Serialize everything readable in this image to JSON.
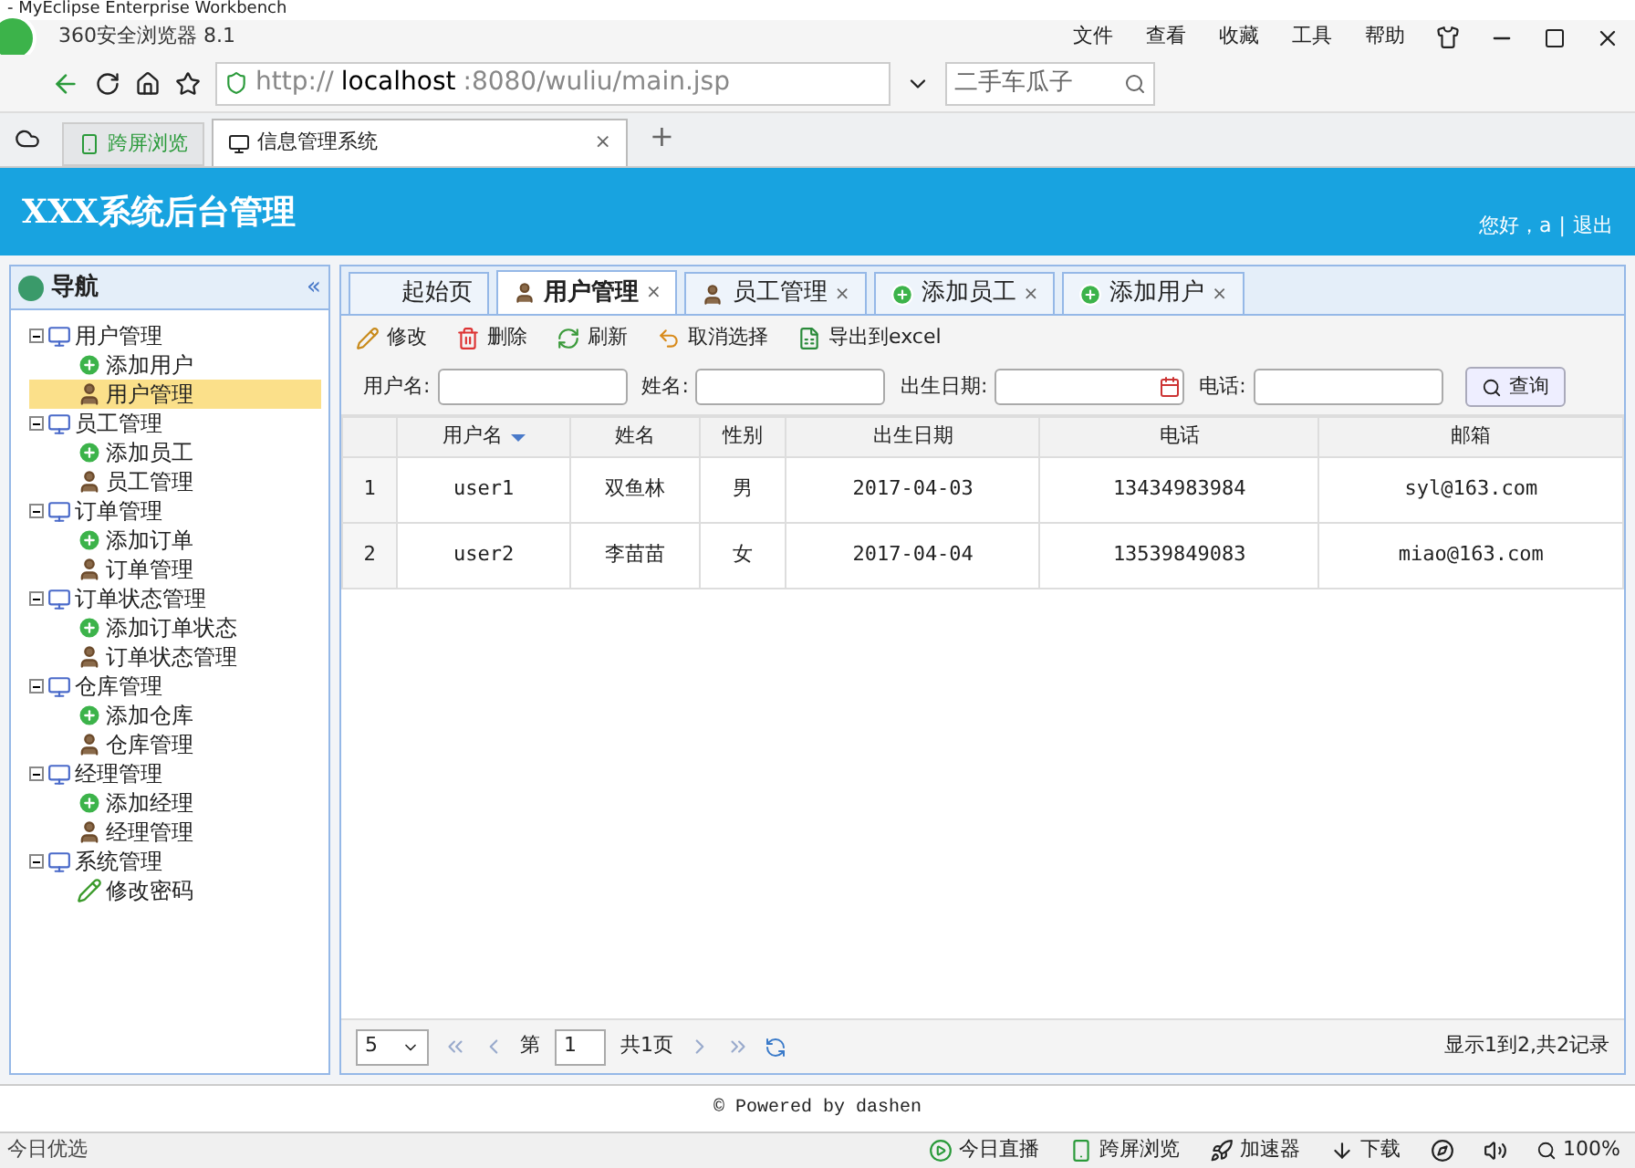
{
  "ide_title": "- MyEclipse Enterprise Workbench",
  "browser": {
    "title": "360安全浏览器 8.1",
    "menu": [
      "文件",
      "查看",
      "收藏",
      "工具",
      "帮助"
    ],
    "url_prefix": "http://",
    "url_host": "localhost",
    "url_rest": ":8080/wuliu/main.jsp",
    "search_placeholder": "二手车瓜子",
    "tabs": [
      {
        "label": "跨屏浏览",
        "kind": "pinned",
        "selected": false
      },
      {
        "label": "信息管理系统",
        "kind": "page",
        "selected": true
      }
    ],
    "tab_close": "×",
    "new_tab": "+"
  },
  "app": {
    "title": "XXX系统后台管理",
    "greeting": "您好，a",
    "separator": "|",
    "logout": "退出"
  },
  "nav": {
    "title": "导航",
    "collapse": "«",
    "groups": [
      {
        "label": "用户管理",
        "expanded": true,
        "children": [
          {
            "label": "添加用户",
            "kind": "add",
            "selected": false
          },
          {
            "label": "用户管理",
            "kind": "user",
            "selected": true
          }
        ]
      },
      {
        "label": "员工管理",
        "expanded": true,
        "children": [
          {
            "label": "添加员工",
            "kind": "add",
            "selected": false
          },
          {
            "label": "员工管理",
            "kind": "user",
            "selected": false
          }
        ]
      },
      {
        "label": "订单管理",
        "expanded": true,
        "children": [
          {
            "label": "添加订单",
            "kind": "add",
            "selected": false
          },
          {
            "label": "订单管理",
            "kind": "user",
            "selected": false
          }
        ]
      },
      {
        "label": "订单状态管理",
        "expanded": true,
        "children": [
          {
            "label": "添加订单状态",
            "kind": "add",
            "selected": false
          },
          {
            "label": "订单状态管理",
            "kind": "user",
            "selected": false
          }
        ]
      },
      {
        "label": "仓库管理",
        "expanded": true,
        "children": [
          {
            "label": "添加仓库",
            "kind": "add",
            "selected": false
          },
          {
            "label": "仓库管理",
            "kind": "user",
            "selected": false
          }
        ]
      },
      {
        "label": "经理管理",
        "expanded": true,
        "children": [
          {
            "label": "添加经理",
            "kind": "add",
            "selected": false
          },
          {
            "label": "经理管理",
            "kind": "user",
            "selected": false
          }
        ]
      },
      {
        "label": "系统管理",
        "expanded": true,
        "children": [
          {
            "label": "修改密码",
            "kind": "pencil",
            "selected": false
          }
        ]
      }
    ]
  },
  "content_tabs": [
    {
      "label": "起始页",
      "kind": "plain",
      "closable": false,
      "selected": false
    },
    {
      "label": "用户管理",
      "kind": "user",
      "closable": true,
      "selected": true
    },
    {
      "label": "员工管理",
      "kind": "user",
      "closable": true,
      "selected": false
    },
    {
      "label": "添加员工",
      "kind": "add",
      "closable": true,
      "selected": false
    },
    {
      "label": "添加用户",
      "kind": "add",
      "closable": true,
      "selected": false
    }
  ],
  "close_mark": "×",
  "toolbar": [
    {
      "label": "修改",
      "kind": "edit"
    },
    {
      "label": "删除",
      "kind": "delete"
    },
    {
      "label": "刷新",
      "kind": "refresh"
    },
    {
      "label": "取消选择",
      "kind": "undo"
    },
    {
      "label": "导出到excel",
      "kind": "export"
    }
  ],
  "filters": [
    {
      "label": "用户名:",
      "kind": "text"
    },
    {
      "label": "姓名:",
      "kind": "text"
    },
    {
      "label": "出生日期:",
      "kind": "date"
    },
    {
      "label": "电话:",
      "kind": "text"
    }
  ],
  "search_button": "查询",
  "table": {
    "columns": [
      {
        "label": "用户名",
        "sorted": true
      },
      {
        "label": "姓名",
        "sorted": false
      },
      {
        "label": "性别",
        "sorted": false
      },
      {
        "label": "出生日期",
        "sorted": false
      },
      {
        "label": "电话",
        "sorted": false
      },
      {
        "label": "邮箱",
        "sorted": false
      }
    ],
    "rows": [
      {
        "index": "1",
        "cells": [
          "user1",
          "双鱼林",
          "男",
          "2017-04-03",
          "13434983984",
          "syl@163.com"
        ]
      },
      {
        "index": "2",
        "cells": [
          "user2",
          "李苗苗",
          "女",
          "2017-04-04",
          "13539849083",
          "miao@163.com"
        ]
      }
    ]
  },
  "pager": {
    "page_size": "5",
    "page_prefix": "第",
    "page": "1",
    "page_suffix": "共1页",
    "summary": "显示1到2,共2记录"
  },
  "footer": "© Powered by dashen",
  "status_bar": {
    "left": "今日优选",
    "items": [
      {
        "label": "今日直播",
        "kind": "play"
      },
      {
        "label": "跨屏浏览",
        "kind": "phone"
      },
      {
        "label": "加速器",
        "kind": "rocket"
      },
      {
        "label": "下载",
        "kind": "download"
      }
    ],
    "zoom": "100%"
  }
}
